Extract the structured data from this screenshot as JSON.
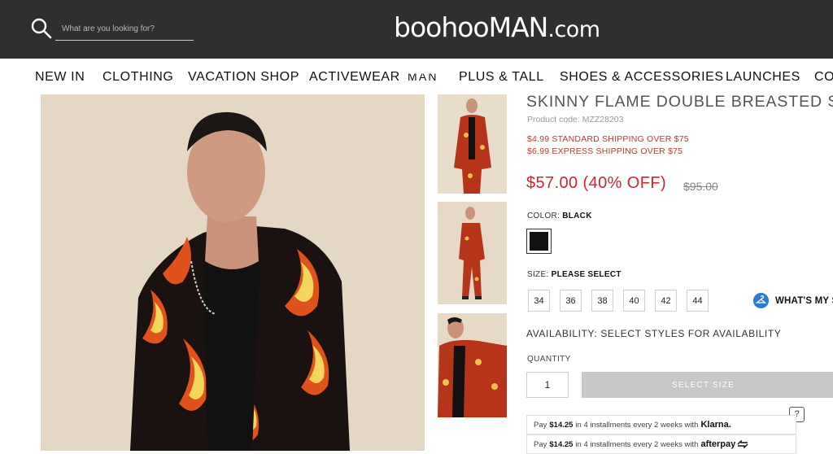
{
  "header": {
    "search_placeholder": "What are you looking for?",
    "logo_main": "boohooMAN",
    "logo_suffix": ".com"
  },
  "nav": {
    "items": [
      "NEW IN",
      "CLOTHING",
      "VACATION SHOP",
      "ACTIVEWEAR",
      "MAN",
      "PLUS & TALL",
      "SHOES & ACCESSORIES",
      "LAUNCHES",
      "CO"
    ]
  },
  "product": {
    "title": "SKINNY FLAME DOUBLE BREASTED SUIT",
    "code": "Product code: MZZ28203",
    "shipping": [
      "$4.99 STANDARD SHIPPING OVER $75",
      "$6.99 EXPRESS SHIPPING OVER $75"
    ],
    "price": "$57.00 (40% OFF)",
    "was_price": "$95.00",
    "color_label": "COLOR:",
    "color_value": "BLACK",
    "size_label": "SIZE:",
    "size_value": "PLEASE SELECT",
    "sizes": [
      "34",
      "36",
      "38",
      "40",
      "42",
      "44"
    ],
    "whats_my_size": "WHAT'S MY SIZE",
    "availability": "AVAILABILITY:  SELECT STYLES FOR AVAILABILITY",
    "quantity_label": "QUANTITY",
    "quantity_value": "1",
    "select_size_button": "SELECT SIZE",
    "help": "?",
    "klarna": {
      "pre": "Pay",
      "amount": "$14.25",
      "post": "in 4 installments every 2 weeks with",
      "brand": "Klarna."
    },
    "afterpay": {
      "pre": "Pay",
      "amount": "$14.25",
      "post": "in 4 installments every 2 weeks with",
      "brand": "afterpay"
    }
  },
  "colors": {
    "header_bg": "#2f2f2f",
    "price_red": "#d0262e",
    "shipping_red": "#c0392b",
    "button_grey": "#c8c8c8",
    "info_blue": "#2b7cd3"
  }
}
